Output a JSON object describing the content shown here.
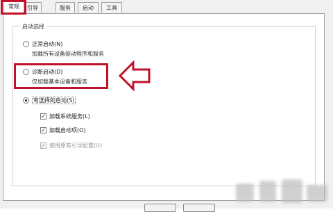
{
  "tabs": [
    {
      "label": "常规",
      "active": true
    },
    {
      "label": "引导",
      "active": false
    },
    {
      "label": "服务",
      "active": false
    },
    {
      "label": "启动",
      "active": false
    },
    {
      "label": "工具",
      "active": false
    }
  ],
  "startup_group": {
    "title": "启动选择",
    "normal": {
      "label": "正常启动(N)",
      "description": "加载所有设备驱动程序和服务",
      "selected": false
    },
    "diagnostic": {
      "label": "诊断启动(D)",
      "description": "仅加载基本设备和服务",
      "selected": false
    },
    "selective": {
      "label": "有选择的启动(S)",
      "selected": true,
      "options": [
        {
          "label": "加载系统服务(L)",
          "checked": true,
          "enabled": true
        },
        {
          "label": "加载启动项(O)",
          "checked": true,
          "enabled": true
        },
        {
          "label": "使用原有引导配置(U)",
          "checked": true,
          "enabled": false
        }
      ]
    }
  },
  "annotation": {
    "highlight_color": "#c0112b"
  },
  "icons": {
    "arrow": "left-arrow-outline-icon"
  }
}
